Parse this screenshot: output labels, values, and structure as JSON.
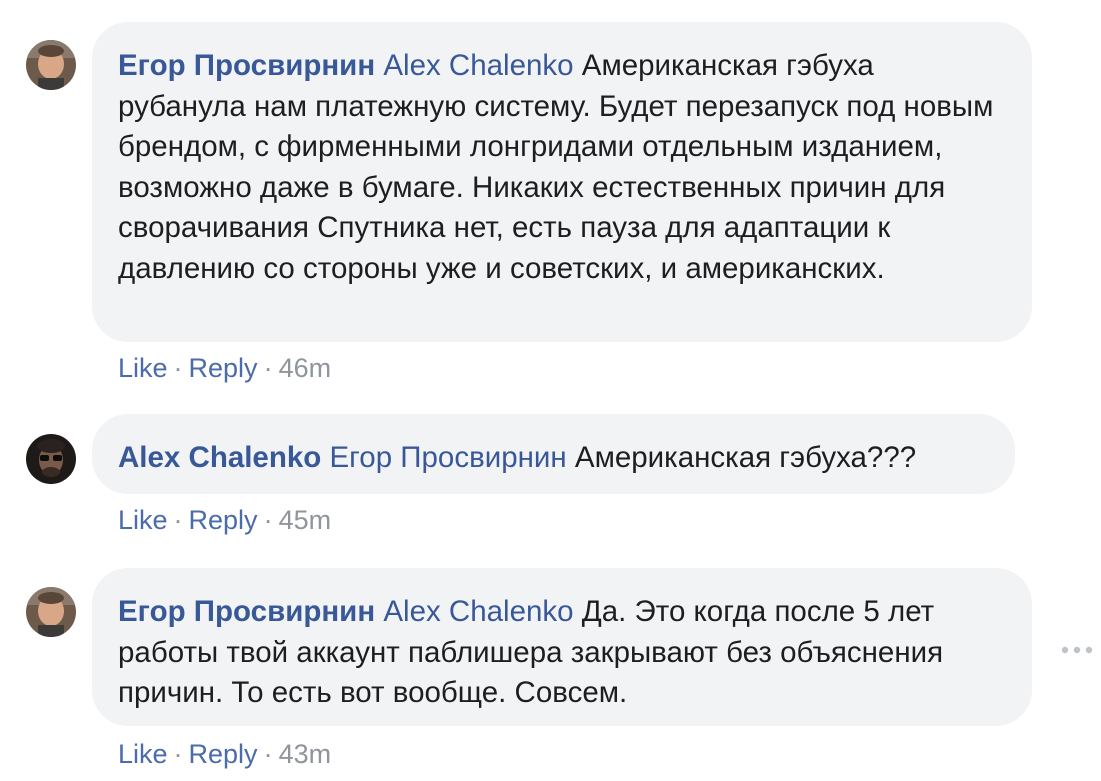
{
  "comments": [
    {
      "author": "Егор Просвирнин",
      "mention": "Alex Chalenko",
      "text": "Американская гэбуха рубанула нам платежную систему. Будет перезапуск под новым брендом, с фирменными лонгридами отдельным изданием, возможно даже в бумаге. Никаких естественных причин для сворачивания Спутника нет, есть пауза для адаптации к давлению со стороны уже и советских, и американских.",
      "like": "Like",
      "reply": "Reply",
      "time": "46m",
      "avatar_icon": "user-avatar-egor"
    },
    {
      "author": "Alex Chalenko",
      "mention": "Егор Просвирнин",
      "text": "Американская гэбуха???",
      "like": "Like",
      "reply": "Reply",
      "time": "45m",
      "avatar_icon": "user-avatar-alex"
    },
    {
      "author": "Егор Просвирнин",
      "mention": "Alex Chalenko",
      "text": "Да. Это когда после 5 лет работы твой аккаунт паблишера закрывают без объяснения причин. То есть вот вообще. Совсем.",
      "like": "Like",
      "reply": "Reply",
      "time": "43m",
      "avatar_icon": "user-avatar-egor"
    }
  ],
  "colors": {
    "bubble": "#f2f3f5",
    "link": "#385898",
    "meta": "#90949c",
    "text": "#1c1e21"
  },
  "more_icon": "more-options-icon"
}
